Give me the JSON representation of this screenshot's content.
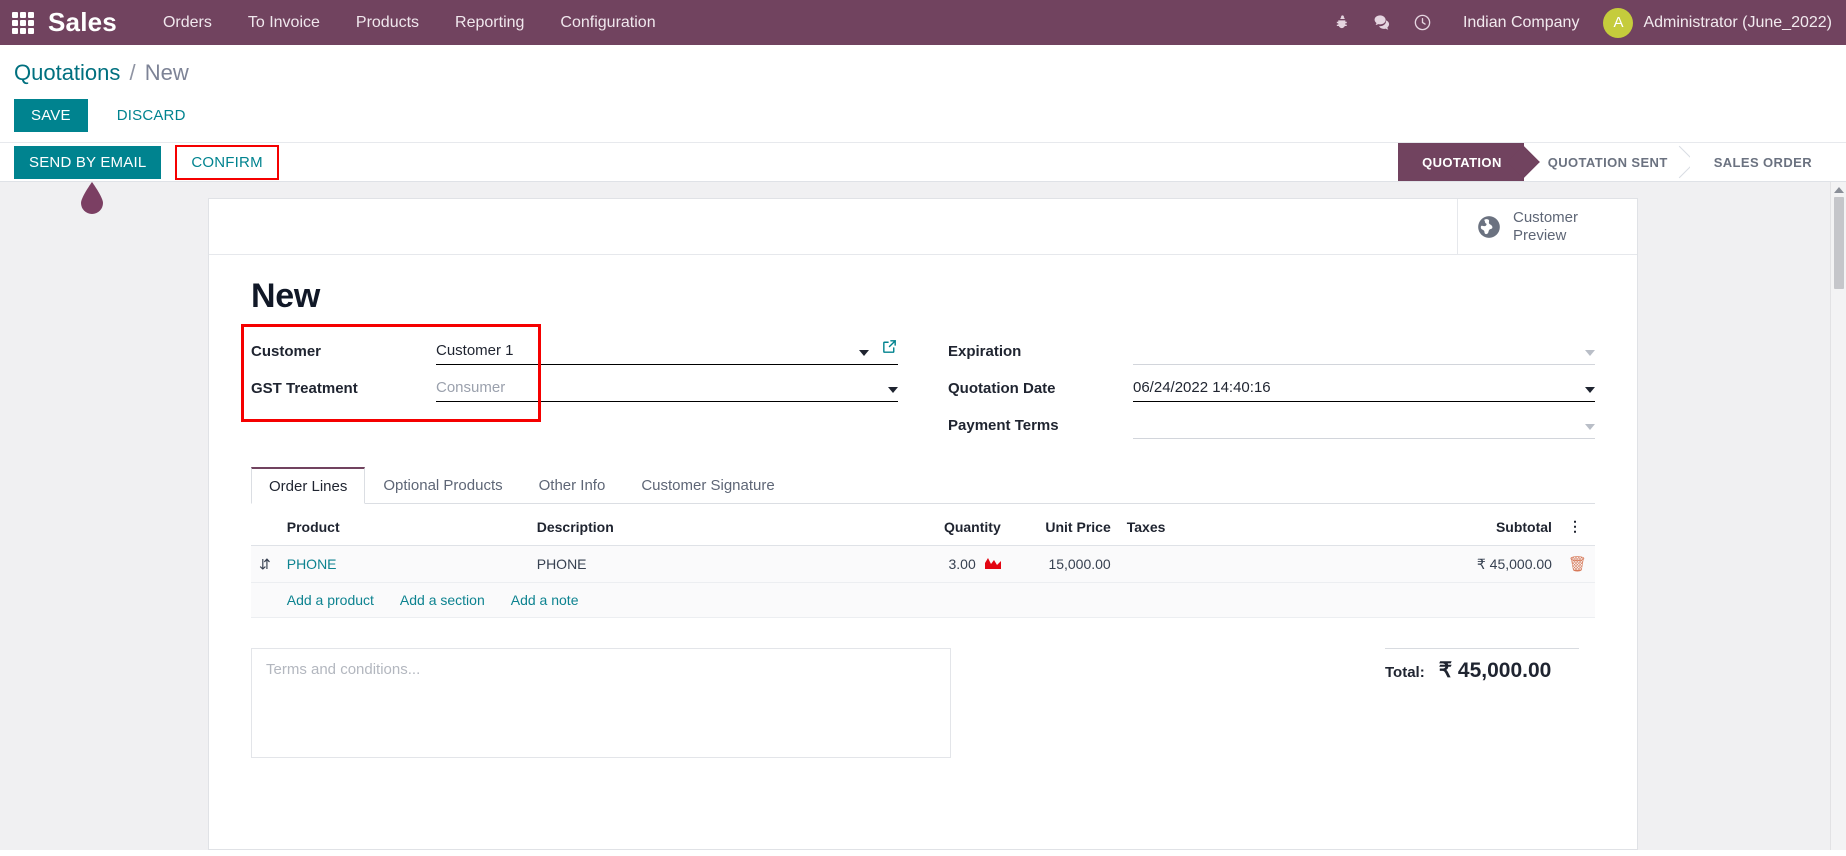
{
  "navbar": {
    "apps_icon": "apps-grid-icon",
    "brand": "Sales",
    "menu": [
      {
        "label": "Orders"
      },
      {
        "label": "To Invoice"
      },
      {
        "label": "Products"
      },
      {
        "label": "Reporting"
      },
      {
        "label": "Configuration"
      }
    ],
    "icons": [
      {
        "name": "bug-icon",
        "glyph": "🐛"
      },
      {
        "name": "messages-icon",
        "glyph": "💬"
      },
      {
        "name": "activities-clock-icon",
        "glyph": "◴"
      }
    ],
    "company": "Indian Company",
    "user": {
      "initial": "A",
      "name": "Administrator (June_2022)"
    },
    "bg_color": "#71435f"
  },
  "control_panel": {
    "breadcrumb": {
      "root": "Quotations",
      "separator": "/",
      "current": "New"
    },
    "save_label": "SAVE",
    "discard_label": "DISCARD"
  },
  "action_bar": {
    "send_by_email_label": "SEND BY EMAIL",
    "confirm_label": "CONFIRM",
    "confirm_highlight_color": "#f50000",
    "statuses": [
      {
        "label": "QUOTATION",
        "active": true
      },
      {
        "label": "QUOTATION SENT",
        "active": false
      },
      {
        "label": "SALES ORDER",
        "active": false
      }
    ],
    "pin_color": "#7b3f63"
  },
  "sheet": {
    "customer_preview": {
      "line1": "Customer",
      "line2": "Preview",
      "icon": "globe-icon"
    },
    "title": "New",
    "left_fields": [
      {
        "label": "Customer",
        "value": "Customer 1",
        "placeholder": "",
        "is_placeholder": false,
        "has_external_link": true,
        "caret": "strong"
      },
      {
        "label": "GST Treatment",
        "value": "Consumer",
        "placeholder": "Consumer",
        "is_placeholder": true,
        "has_external_link": false,
        "caret": "strong"
      }
    ],
    "right_fields": [
      {
        "label": "Expiration",
        "value": "",
        "caret": "dim",
        "underline": "light"
      },
      {
        "label": "Quotation Date",
        "value": "06/24/2022 14:40:16",
        "caret": "strong",
        "underline": "dark"
      },
      {
        "label": "Payment Terms",
        "value": "",
        "caret": "dim",
        "underline": "light"
      }
    ],
    "annotation_color": "#f50000"
  },
  "notebook": {
    "tabs": [
      {
        "label": "Order Lines",
        "active": true
      },
      {
        "label": "Optional Products",
        "active": false
      },
      {
        "label": "Other Info",
        "active": false
      },
      {
        "label": "Customer Signature",
        "active": false
      }
    ]
  },
  "order_lines": {
    "columns": [
      "Product",
      "Description",
      "Quantity",
      "Unit Price",
      "Taxes",
      "Subtotal"
    ],
    "optional_columns_icon": "vertical-dots-icon",
    "rows": [
      {
        "drag_handle": "drag-handle-icon",
        "product": "PHONE",
        "description": "PHONE",
        "quantity": "3.00",
        "forecast_icon": "forecast-area-chart-icon",
        "forecast_color": "#e30613",
        "unit_price": "15,000.00",
        "taxes": "",
        "subtotal": "₹ 45,000.00",
        "delete_icon": "trash-icon"
      }
    ],
    "add_links": [
      {
        "label": "Add a product"
      },
      {
        "label": "Add a section"
      },
      {
        "label": "Add a note"
      }
    ]
  },
  "footer": {
    "terms_placeholder": "Terms and conditions...",
    "total_label": "Total:",
    "total_value": "₹ 45,000.00"
  },
  "scrollbar": {
    "name": "vertical-scrollbar"
  }
}
